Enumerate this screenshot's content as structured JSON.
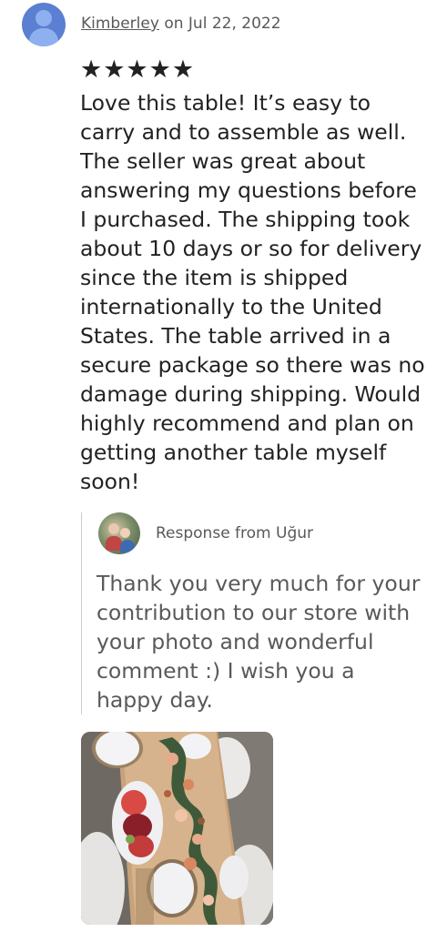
{
  "review": {
    "author": "Kimberley",
    "date_text": " on Jul 22, 2022",
    "stars": "★★★★★",
    "text": "Love this table! It’s easy to carry and to assemble as well. The seller was great about answering my questions before I purchased. The shipping took about 10 days or so for delivery since the item is shipped internationally to the United States. The table arrived in a secure package so there was no damage during shipping. Would highly recommend and plan on getting another table myself soon!"
  },
  "response": {
    "label": "Response from Uğur",
    "text": "Thank you very much for your contribution to our store with your photo and wonderful comment :) I wish you a happy day."
  },
  "icons": {
    "reviewer_avatar": "user-placeholder-icon",
    "shop_avatar": "shop-owner-photo"
  },
  "colors": {
    "avatar_bg": "#5b7fd1",
    "muted_text": "#595959",
    "body_text": "#222222"
  }
}
